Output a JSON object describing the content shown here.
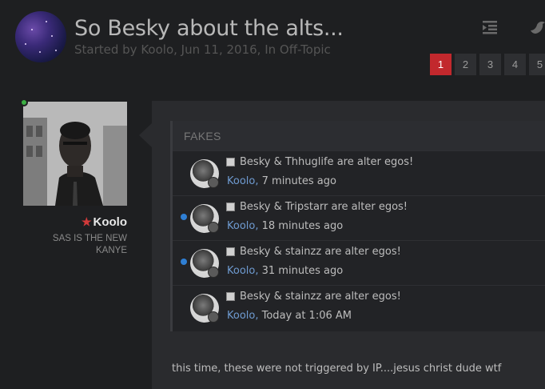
{
  "topic": {
    "title": "So Besky about the alts...",
    "meta": "Started by Koolo, Jun 11, 2016, In Off-Topic"
  },
  "header_icons": [
    "list-indent-icon",
    "twitter-bird-icon"
  ],
  "pagination": {
    "pages": [
      "1",
      "2",
      "3",
      "4",
      "5"
    ],
    "current": "1"
  },
  "author": {
    "name": "Koolo",
    "title": "SAS IS THE NEW KANYE",
    "online": true
  },
  "quote": {
    "header": "FAKES",
    "items": [
      {
        "title": "Besky & Thhuglife are alter egos!",
        "author": "Koolo,",
        "time": "7 minutes ago",
        "unread": false
      },
      {
        "title": "Besky & Tripstarr are alter egos!",
        "author": "Koolo,",
        "time": "18 minutes ago",
        "unread": true
      },
      {
        "title": "Besky & stainzz are alter egos!",
        "author": "Koolo,",
        "time": "31 minutes ago",
        "unread": true
      },
      {
        "title": "Besky & stainzz are alter egos!",
        "author": "Koolo,",
        "time": "Today at 1:06 AM",
        "unread": false
      }
    ]
  },
  "post_body": "this time, these were not triggered by IP....jesus christ dude wtf",
  "colors": {
    "accent_red": "#c2282d",
    "unread_blue": "#2f7fd4",
    "online_green": "#3cb043",
    "link_blue": "#6f9bd1"
  }
}
